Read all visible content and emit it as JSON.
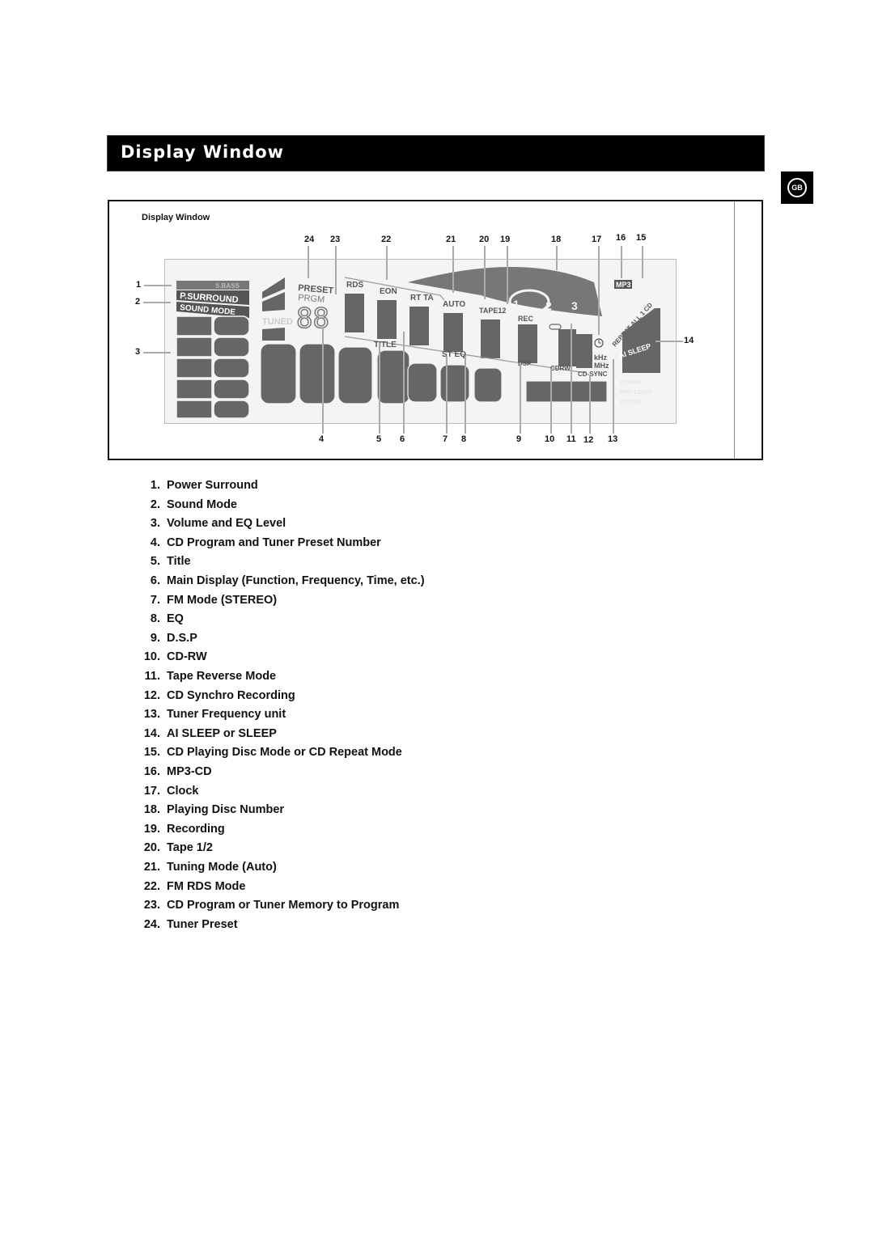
{
  "page": {
    "title": "Display Window",
    "language_badge": "GB"
  },
  "figure": {
    "caption": "Display Window",
    "callouts_top": [
      "24",
      "23",
      "22",
      "21",
      "20",
      "19",
      "18",
      "17",
      "16",
      "15"
    ],
    "callouts_left": [
      "1",
      "2",
      "3"
    ],
    "callouts_right": [
      "14"
    ],
    "callouts_bottom": [
      "4",
      "5",
      "6",
      "7",
      "8",
      "9",
      "10",
      "11",
      "12",
      "13"
    ],
    "lcd_labels": {
      "s_bass": "S.BASS",
      "p_surround": "P.SURROUND",
      "sound_mode": "SOUND MODE",
      "tuned": "TUNED",
      "preset": "PRESET",
      "prgm": "PRGM",
      "preset_digits": "88",
      "rds": "RDS",
      "eon": "EON",
      "rt_ta": "RT TA",
      "auto": "AUTO",
      "tape12": "TAPE12",
      "rec": "REC",
      "title": "TITLE",
      "st_eq": "ST EQ",
      "dsp": "DSP",
      "cdrw": "CDRW",
      "cd_sync": "CD-SYNC",
      "khz": "kHz",
      "mhz": "MHz",
      "mp3": "MP3",
      "repeat_all_1_cd": "REPEAT ALL 1 CD",
      "ai_sleep": "AI SLEEP",
      "disc_1": "1",
      "disc_2": "2",
      "disc_3": "3",
      "dolby_1": "DTS/EB",
      "dolby_2": "PRO-LOGIC",
      "dolby_3": "DIGITAL"
    }
  },
  "legend": [
    {
      "num": "1.",
      "text": "Power Surround"
    },
    {
      "num": "2.",
      "text": "Sound Mode"
    },
    {
      "num": "3.",
      "text": "Volume and EQ Level"
    },
    {
      "num": "4.",
      "text": "CD Program and Tuner Preset Number"
    },
    {
      "num": "5.",
      "text": "Title"
    },
    {
      "num": "6.",
      "text": " Main Display (Function, Frequency, Time, etc.)"
    },
    {
      "num": "7.",
      "text": "FM Mode (STEREO)"
    },
    {
      "num": "8.",
      "text": "EQ"
    },
    {
      "num": "9.",
      "text": "D.S.P"
    },
    {
      "num": "10.",
      "text": "CD-RW"
    },
    {
      "num": "11.",
      "text": "Tape Reverse Mode"
    },
    {
      "num": "12.",
      "text": "CD Synchro Recording"
    },
    {
      "num": "13.",
      "text": "Tuner Frequency unit"
    },
    {
      "num": "14.",
      "text": "AI SLEEP or SLEEP"
    },
    {
      "num": "15.",
      "text": "CD Playing Disc Mode or CD Repeat Mode"
    },
    {
      "num": "16.",
      "text": "MP3-CD"
    },
    {
      "num": "17.",
      "text": "Clock"
    },
    {
      "num": "18.",
      "text": "Playing Disc Number"
    },
    {
      "num": "19.",
      "text": "Recording"
    },
    {
      "num": "20.",
      "text": "Tape 1/2"
    },
    {
      "num": "21.",
      "text": "Tuning  Mode (Auto)"
    },
    {
      "num": "22.",
      "text": "FM RDS Mode"
    },
    {
      "num": "23.",
      "text": "CD Program or Tuner Memory to Program"
    },
    {
      "num": "24.",
      "text": "Tuner Preset"
    }
  ]
}
